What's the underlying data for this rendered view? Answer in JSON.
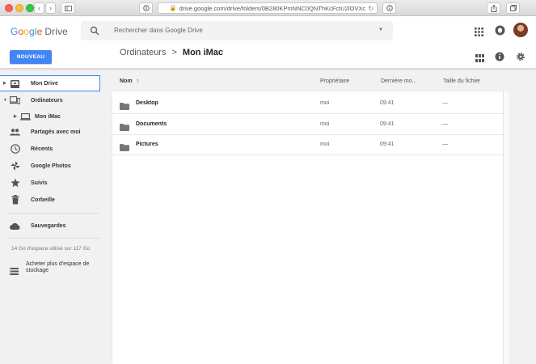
{
  "browser": {
    "url": "drive.google.com/drive/folders/0B280KPmNNC0QNThKcFctU2lOVXc",
    "newtab_label": "+"
  },
  "header": {
    "logo": [
      "G",
      "o",
      "o",
      "g",
      "l",
      "e"
    ],
    "product": "Drive",
    "search_placeholder": "Rechercher dans Google Drive"
  },
  "toolbar": {
    "new_label": "NOUVEAU",
    "breadcrumb_parent": "Ordinateurs",
    "breadcrumb_separator": ">",
    "breadcrumb_current": "Mon iMac"
  },
  "sidebar": {
    "items": [
      {
        "label": "Mon Drive",
        "icon": "my-drive-icon"
      },
      {
        "label": "Ordinateurs",
        "icon": "computers-icon"
      },
      {
        "label": "Mon iMac",
        "icon": "laptop-icon"
      },
      {
        "label": "Partagés avec moi",
        "icon": "people-icon"
      },
      {
        "label": "Récents",
        "icon": "clock-icon"
      },
      {
        "label": "Google Photos",
        "icon": "pinwheel-icon"
      },
      {
        "label": "Suivis",
        "icon": "star-icon"
      },
      {
        "label": "Corbeille",
        "icon": "trash-icon"
      },
      {
        "label": "Sauvegardes",
        "icon": "cloud-icon"
      }
    ],
    "quota": "14 Go d'espace utilisé sur 117 Go",
    "buy_storage": "Acheter plus d'espace de stockage"
  },
  "table": {
    "columns": {
      "name": "Nom",
      "owner": "Propriétaire",
      "modified": "Dernière mo...",
      "size": "Taille du fichier"
    },
    "rows": [
      {
        "name": "Desktop",
        "owner": "moi",
        "modified": "09:41",
        "size": "—"
      },
      {
        "name": "Documents",
        "owner": "moi",
        "modified": "09:41",
        "size": "—"
      },
      {
        "name": "Pictures",
        "owner": "moi",
        "modified": "09:41",
        "size": "—"
      }
    ]
  },
  "colors": {
    "accent": "#4285f4",
    "folder": "#777777"
  }
}
